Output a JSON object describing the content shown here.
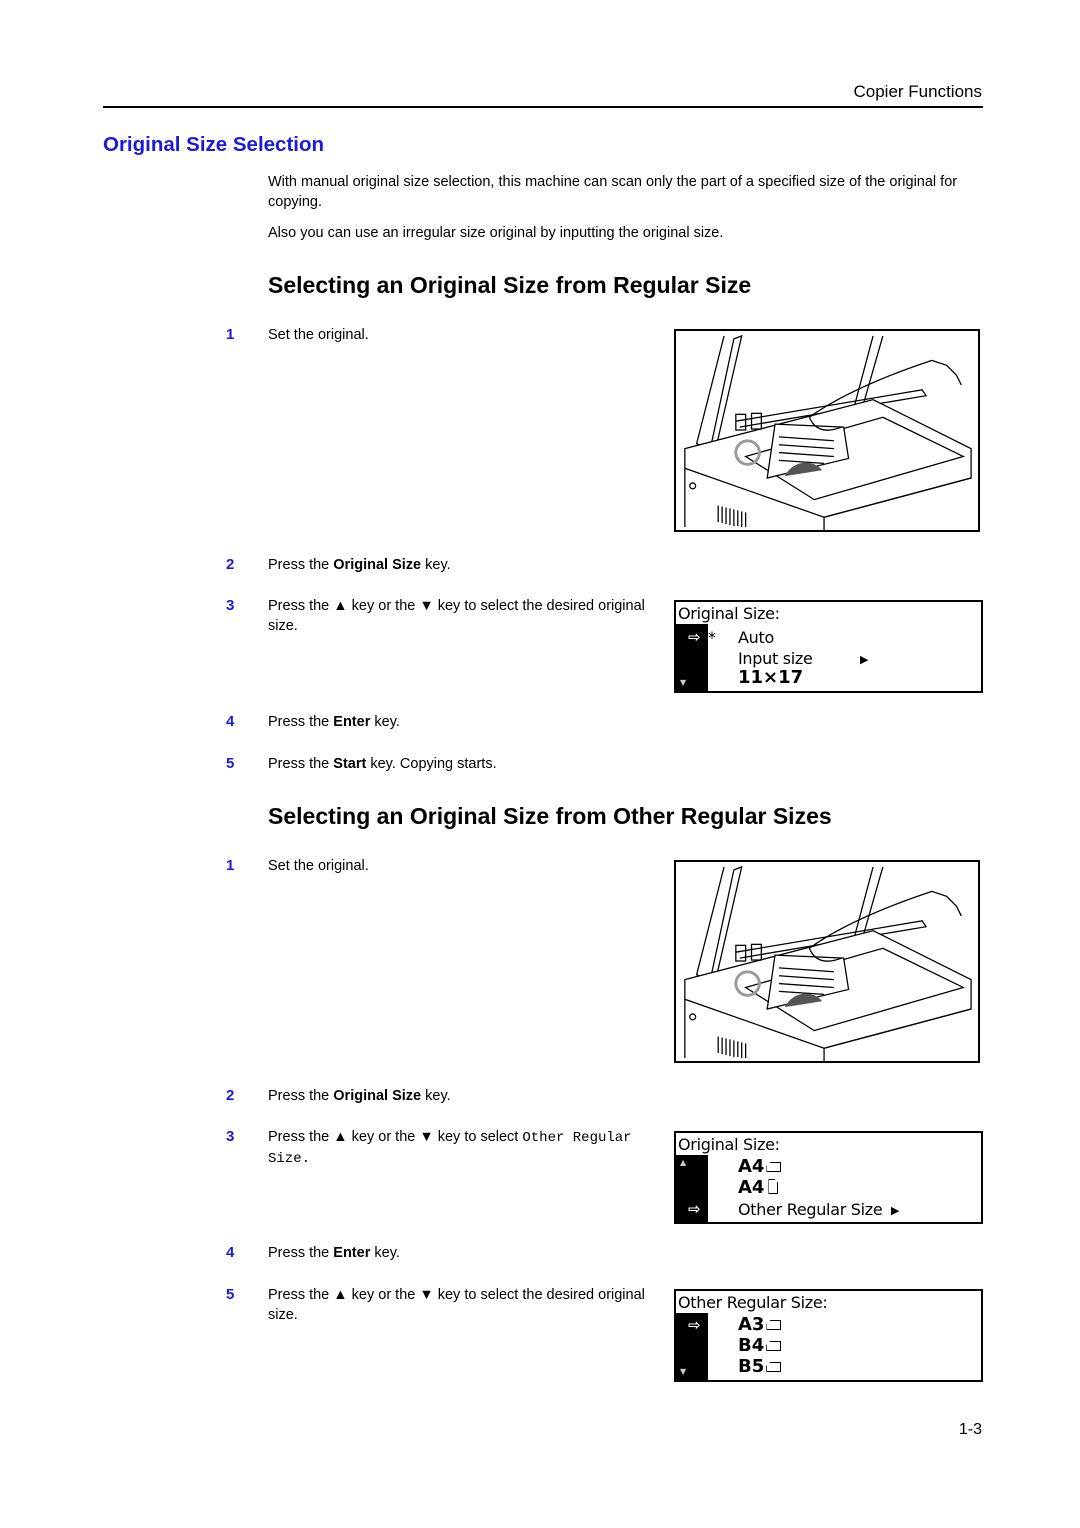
{
  "header": {
    "running_head": "Copier Functions"
  },
  "section": {
    "title": "Original Size Selection",
    "intro": [
      "With manual original size selection, this machine can scan only the part of a specified size of the original for copying.",
      "Also you can use an irregular size original by inputting the original size."
    ]
  },
  "procedure_regular": {
    "heading": "Selecting an Original Size from Regular Size",
    "steps": [
      {
        "num": "1",
        "text": "Set the original."
      },
      {
        "num": "2",
        "pre": "Press the ",
        "bold": "Original Size",
        "post": " key."
      },
      {
        "num": "3",
        "text": "Press the ▲ key or the ▼ key to select the desired original size."
      },
      {
        "num": "4",
        "pre": "Press the ",
        "bold": "Enter",
        "post": " key."
      },
      {
        "num": "5",
        "pre": "Press the ",
        "bold": "Start",
        "post": " key. Copying starts."
      }
    ],
    "lcd": {
      "title": "Original Size:",
      "rows": [
        {
          "label": "Auto",
          "selected": true,
          "default_mark": "*"
        },
        {
          "label": "Input size",
          "has_submenu": true
        },
        {
          "label": "11×17"
        }
      ],
      "cursor_icon": "arrow-right-icon",
      "scroll_icon": "scroll-down-icon"
    }
  },
  "procedure_other": {
    "heading": "Selecting an Original Size from Other Regular Sizes",
    "steps": [
      {
        "num": "1",
        "text": "Set the original."
      },
      {
        "num": "2",
        "pre": "Press the ",
        "bold": "Original Size",
        "post": " key."
      },
      {
        "num": "3",
        "pre": "Press the ▲ key or the ▼ key to select ",
        "mono": "Other Regular Size",
        "post": "."
      },
      {
        "num": "4",
        "pre": "Press the ",
        "bold": "Enter",
        "post": " key."
      },
      {
        "num": "5",
        "text": "Press the ▲ key or the ▼ key to select the desired original size."
      }
    ],
    "lcd_1": {
      "title": "Original Size:",
      "rows": [
        {
          "label": "A4",
          "orientation": "landscape"
        },
        {
          "label": "A4",
          "orientation": "portrait"
        },
        {
          "label": "Other Regular Size",
          "selected": true,
          "has_submenu": true
        }
      ],
      "scroll_icon": "scroll-up-icon"
    },
    "lcd_2": {
      "title": "Other Regular Size:",
      "rows": [
        {
          "label": "A3",
          "orientation": "landscape",
          "selected": true
        },
        {
          "label": "B4",
          "orientation": "landscape"
        },
        {
          "label": "B5",
          "orientation": "landscape"
        }
      ],
      "scroll_icon": "scroll-down-icon"
    }
  },
  "figures": {
    "set_original_alt": "Placing an original face down on the platen glass"
  },
  "footer": {
    "page_number": "1-3"
  }
}
